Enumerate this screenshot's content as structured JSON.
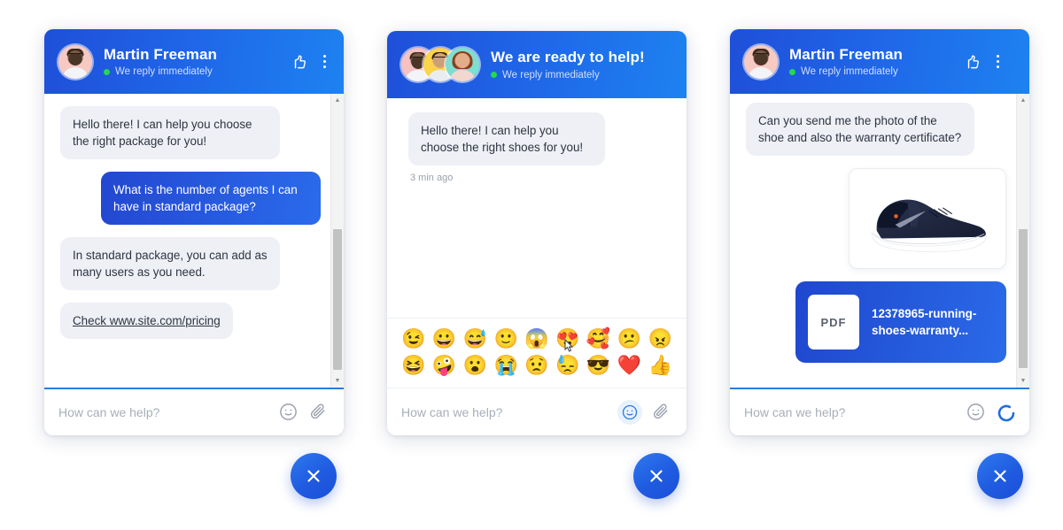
{
  "theme": {
    "brand_blue": "#1f5be0",
    "brand_blue_light": "#1e82f0",
    "bubble_in_bg": "#eef0f6",
    "bubble_out_bg": "#2a6bec",
    "status_dot_green": "#25d94a",
    "input_accent": "#2a7ae4",
    "page_bg": "#ffffff"
  },
  "common": {
    "input_placeholder": "How can we help?",
    "status_text": "We reply immediately",
    "like_icon": "thumbs-up-icon",
    "menu_icon": "kebab-menu-icon",
    "emoji_icon": "smiley-face-icon",
    "attach_icon": "paperclip-icon",
    "spinner_icon": "loading-spinner-icon",
    "close_icon": "close-x-icon"
  },
  "panels": [
    {
      "id": "pricing-chat",
      "header": {
        "title": "Martin Freeman",
        "status": "We reply immediately",
        "avatar_type": "single"
      },
      "messages": [
        {
          "kind": "in",
          "text": "Hello there! I can help you choose the right package for you!"
        },
        {
          "kind": "out",
          "text": "What is the number of agents I can have in standard package?"
        },
        {
          "kind": "in",
          "text": "In standard package, you can add as many users as you need."
        },
        {
          "kind": "link",
          "prefix": "Check ",
          "link": "www.site.com/pricing"
        }
      ],
      "scrollbar": {
        "visible": true,
        "thumb_top_pct": 46,
        "thumb_height_pct": 48
      },
      "input": {
        "placeholder": "How can we help?",
        "caret": true,
        "emoji_active": false,
        "right_icon": "paperclip-icon"
      }
    },
    {
      "id": "shoes-chat-emoji",
      "header": {
        "title": "We are ready to help!",
        "status": "We reply immediately",
        "avatar_type": "group"
      },
      "messages": [
        {
          "kind": "in",
          "text": "Hello there! I can help you choose the right shoes for you!"
        }
      ],
      "timestamp": "3 min ago",
      "scrollbar": {
        "visible": false
      },
      "emoji_picker": {
        "visible": true,
        "hover_index": 5,
        "rows": [
          [
            {
              "glyph": "😉",
              "name": "emoji-wink"
            },
            {
              "glyph": "😀",
              "name": "emoji-grin"
            },
            {
              "glyph": "😅",
              "name": "emoji-sweat-smile"
            },
            {
              "glyph": "🙂",
              "name": "emoji-slight-smile"
            },
            {
              "glyph": "😱",
              "name": "emoji-scream"
            },
            {
              "glyph": "😍",
              "name": "emoji-heart-eyes"
            },
            {
              "glyph": "🥰",
              "name": "emoji-smiling-face-with-hearts"
            },
            {
              "glyph": "😕",
              "name": "emoji-confused"
            },
            {
              "glyph": "😠",
              "name": "emoji-angry"
            }
          ],
          [
            {
              "glyph": "😆",
              "name": "emoji-laughing-squint"
            },
            {
              "glyph": "🤪",
              "name": "emoji-zany-face"
            },
            {
              "glyph": "😮",
              "name": "emoji-open-mouth"
            },
            {
              "glyph": "😭",
              "name": "emoji-loudly-crying"
            },
            {
              "glyph": "😟",
              "name": "emoji-worried"
            },
            {
              "glyph": "😓",
              "name": "emoji-downcast-with-sweat"
            },
            {
              "glyph": "😎",
              "name": "emoji-sunglasses"
            },
            {
              "glyph": "❤️",
              "name": "emoji-red-heart"
            },
            {
              "glyph": "👍",
              "name": "emoji-thumbs-up"
            }
          ]
        ]
      },
      "input": {
        "placeholder": "How can we help?",
        "caret": false,
        "emoji_active": true,
        "right_icon": "paperclip-icon"
      }
    },
    {
      "id": "shoes-chat-attachments",
      "header": {
        "title": "Martin Freeman",
        "status": "We reply immediately",
        "avatar_type": "single"
      },
      "messages": [
        {
          "kind": "in",
          "text": "Can you send me the photo of the shoe and also the warranty certificate?"
        },
        {
          "kind": "image",
          "name": "running-shoe-photo",
          "alt": "navy running shoe"
        },
        {
          "kind": "file",
          "badge": "PDF",
          "filename": "12378965-running-shoes-warranty..."
        }
      ],
      "scrollbar": {
        "visible": true,
        "thumb_top_pct": 52,
        "thumb_height_pct": 42
      },
      "input": {
        "placeholder": "How can we help?",
        "caret": true,
        "emoji_active": false,
        "right_icon": "loading-spinner-icon"
      }
    }
  ]
}
